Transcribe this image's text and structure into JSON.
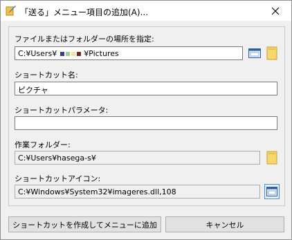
{
  "window": {
    "title": "「送る」メニュー項目の追加(A)..."
  },
  "fields": {
    "location_label": "ファイルまたはフォルダーの場所を指定:",
    "location_prefix": "C:¥Users¥",
    "location_suffix": "¥Pictures",
    "shortcut_name_label": "ショートカット名:",
    "shortcut_name_value": "ピクチャ",
    "params_label": "ショートカットパラメータ:",
    "params_value": "",
    "workdir_label": "作業フォルダー:",
    "workdir_value": "C:¥Users¥hasega-s¥",
    "icon_label": "ショートカットアイコン:",
    "icon_value": "C:¥Windows¥System32¥imageres.dll,108"
  },
  "buttons": {
    "create_label": "ショートカットを作成してメニューに追加",
    "cancel_label": "キャンセル"
  },
  "icons": {
    "title": "send-to-app-icon",
    "close": "close-icon",
    "browse_window": "window-browse-icon",
    "browse_folder": "folder-icon",
    "icon_picker": "icon-picker-icon"
  },
  "colors": {
    "accent_blue": "#4f8fd6",
    "folder_yellow": "#f5d76e"
  }
}
